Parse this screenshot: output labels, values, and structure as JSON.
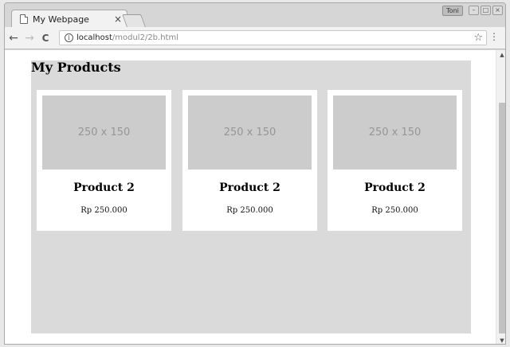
{
  "browser": {
    "tab_title": "My Webpage",
    "tab_close": "×",
    "user_badge": "Toni",
    "url_host": "localhost",
    "url_path": "/modul2/2b.html",
    "back_icon": "←",
    "forward_icon": "→",
    "reload_icon": "C",
    "info_icon": "i",
    "star_icon": "☆",
    "menu_icon": "⋮"
  },
  "page": {
    "heading": "My Products",
    "products": [
      {
        "image_label": "250 x 150",
        "name": "Product 2",
        "price": "Rp 250.000"
      },
      {
        "image_label": "250 x 150",
        "name": "Product 2",
        "price": "Rp 250.000"
      },
      {
        "image_label": "250 x 150",
        "name": "Product 2",
        "price": "Rp 250.000"
      }
    ]
  }
}
